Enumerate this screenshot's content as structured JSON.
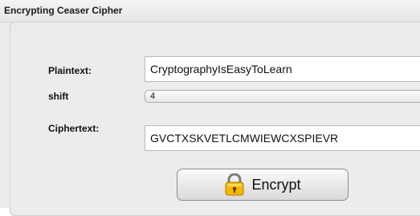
{
  "window": {
    "title": "Encrypting Ceaser Cipher"
  },
  "form": {
    "plaintext_label": "Plaintext:",
    "plaintext_value": "CryptographyIsEasyToLearn",
    "shift_label": "shift",
    "shift_value": "4",
    "ciphertext_label": "Ciphertext:",
    "ciphertext_value": "GVCTXSKVETLCMWIEWCXSPIEVR"
  },
  "actions": {
    "encrypt_label": "Encrypt",
    "encrypt_icon": "lock-icon"
  },
  "colors": {
    "lock_body": "#f5b700",
    "lock_shackle": "#7a7a7a"
  }
}
